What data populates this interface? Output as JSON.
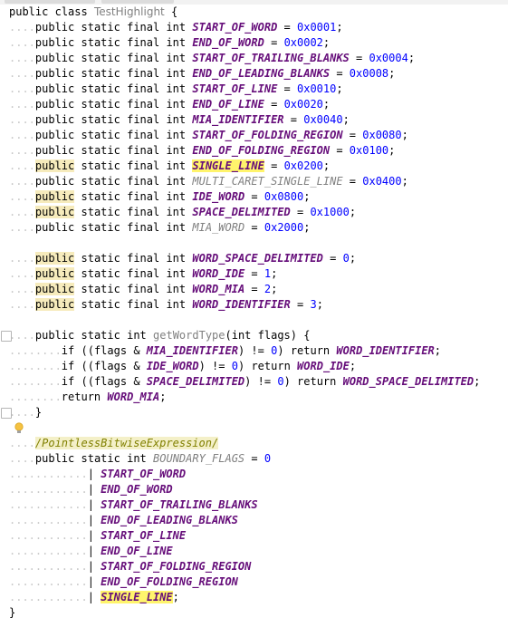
{
  "editor": {
    "lines": [
      {
        "t": "public class TestHighlight {"
      },
      {
        "t": "....public static final int START_OF_WORD = 0x0001;"
      },
      {
        "t": "....public static final int END_OF_WORD = 0x0002;"
      },
      {
        "t": "....public static final int START_OF_TRAILING_BLANKS = 0x0004;"
      },
      {
        "t": "....public static final int END_OF_LEADING_BLANKS = 0x0008;"
      },
      {
        "t": "....public static final int START_OF_LINE = 0x0010;"
      },
      {
        "t": "....public static final int END_OF_LINE = 0x0020;"
      },
      {
        "t": "....public static final int MIA_IDENTIFIER = 0x0040;"
      },
      {
        "t": "....public static final int START_OF_FOLDING_REGION = 0x0080;"
      },
      {
        "t": "....public static final int END_OF_FOLDING_REGION = 0x0100;"
      },
      {
        "t": "....public static final int SINGLE_LINE = 0x0200;"
      },
      {
        "t": "....public static final int MULTI_CARET_SINGLE_LINE = 0x0400;"
      },
      {
        "t": "....public static final int IDE_WORD = 0x0800;"
      },
      {
        "t": "....public static final int SPACE_DELIMITED = 0x1000;"
      },
      {
        "t": "....public static final int MIA_WORD = 0x2000;"
      },
      {
        "t": ""
      },
      {
        "t": "....public static final int WORD_SPACE_DELIMITED = 0;"
      },
      {
        "t": "....public static final int WORD_IDE = 1;"
      },
      {
        "t": "....public static final int WORD_MIA = 2;"
      },
      {
        "t": "....public static final int WORD_IDENTIFIER = 3;"
      },
      {
        "t": ""
      },
      {
        "t": "....public static int getWordType(int flags) {"
      },
      {
        "t": "........if ((flags & MIA_IDENTIFIER) != 0) return WORD_IDENTIFIER;"
      },
      {
        "t": "........if ((flags & IDE_WORD) != 0) return WORD_IDE;"
      },
      {
        "t": "........if ((flags & SPACE_DELIMITED) != 0) return WORD_SPACE_DELIMITED;"
      },
      {
        "t": "........return WORD_MIA;"
      },
      {
        "t": "....}"
      },
      {
        "t": ""
      },
      {
        "t": "..../PointlessBitwiseExpression/"
      },
      {
        "t": "....public static int BOUNDARY_FLAGS = 0"
      },
      {
        "t": "............| START_OF_WORD"
      },
      {
        "t": "............| END_OF_WORD"
      },
      {
        "t": "............| START_OF_TRAILING_BLANKS"
      },
      {
        "t": "............| END_OF_LEADING_BLANKS"
      },
      {
        "t": "............| START_OF_LINE"
      },
      {
        "t": "............| END_OF_LINE"
      },
      {
        "t": "............| START_OF_FOLDING_REGION"
      },
      {
        "t": "............| END_OF_FOLDING_REGION"
      },
      {
        "t": "............| SINGLE_LINE;"
      },
      {
        "t": "}"
      }
    ]
  },
  "colors": {
    "keyword": "#000080",
    "constant": "#660e7a",
    "number": "#0000ff",
    "comment": "#808000",
    "selection_highlight": "#fff46c",
    "usage_highlight": "#f6ebbc"
  },
  "icons": [
    "fold-icon",
    "intention-bulb-icon"
  ]
}
